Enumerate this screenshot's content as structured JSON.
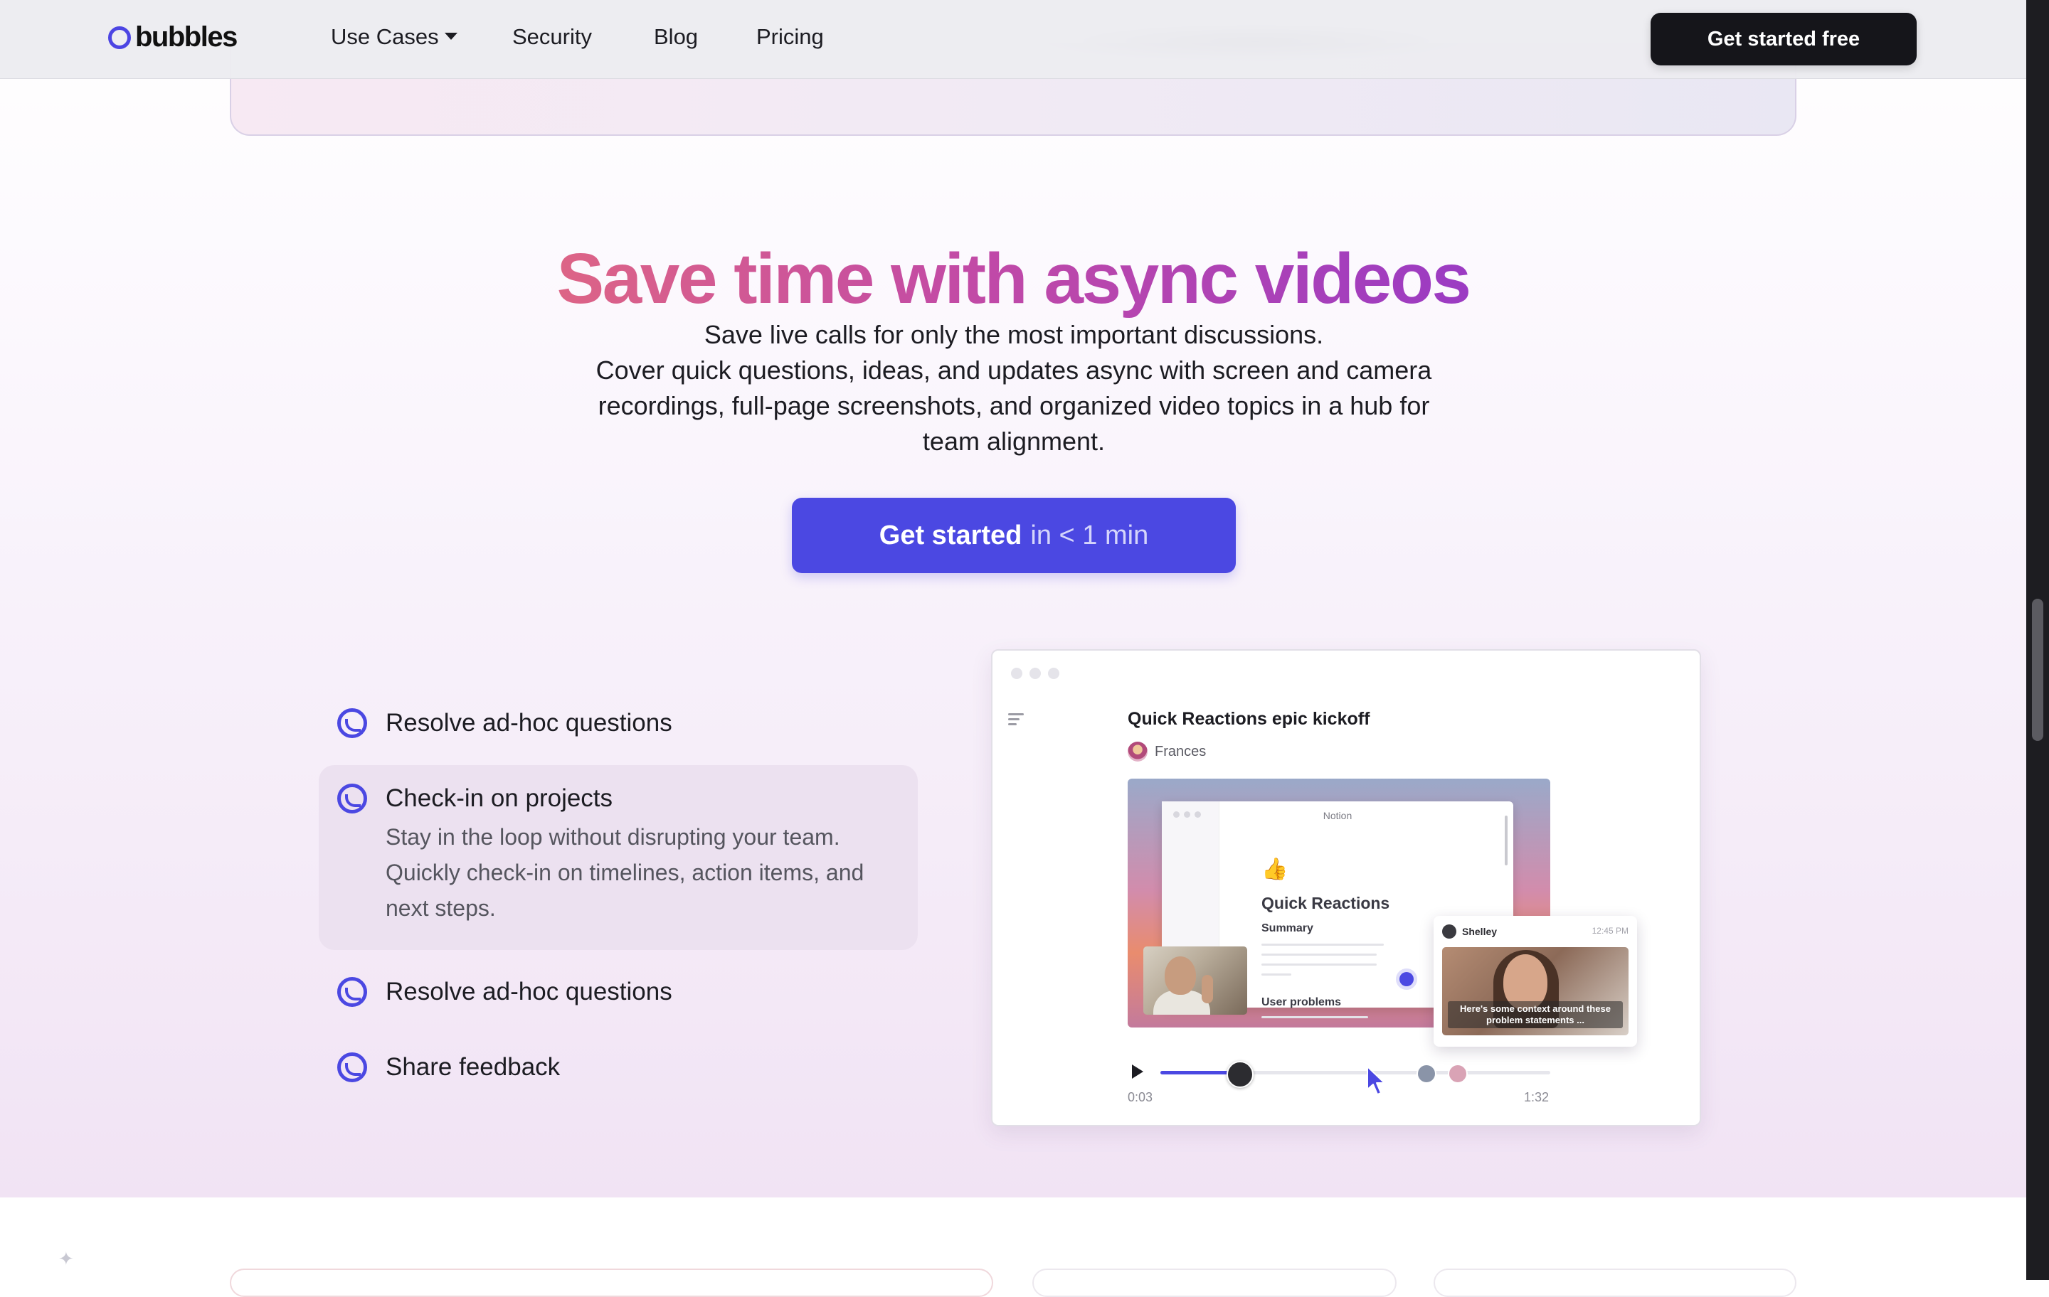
{
  "nav": {
    "brand": "bubbles",
    "items": [
      {
        "label": "Use Cases"
      },
      {
        "label": "Security"
      },
      {
        "label": "Blog"
      },
      {
        "label": "Pricing"
      }
    ],
    "cta_label": "Get started free"
  },
  "hero": {
    "headline": "Save time with async videos",
    "lines": [
      "Save live calls for only the most important discussions.",
      "Cover quick questions, ideas, and updates async with screen and camera recordings, full-page screenshots, and organized video topics in a hub for team alignment."
    ],
    "cta_bold": "Get started",
    "cta_muted": "in < 1 min"
  },
  "features": [
    {
      "title": "Resolve ad-hoc questions",
      "active": false
    },
    {
      "title": "Check-in on projects",
      "active": true,
      "description": "Stay in the loop without disrupting your team. Quickly check-in on timelines, action items, and next steps."
    },
    {
      "title": "Resolve ad-hoc questions",
      "active": false
    },
    {
      "title": "Share feedback",
      "active": false
    }
  ],
  "demo": {
    "title": "Quick Reactions epic kickoff",
    "author": "Frances",
    "inner_window": {
      "app_label": "Notion",
      "emoji": "👍",
      "heading": "Quick Reactions",
      "summary_label": "Summary",
      "problems_label": "User problems"
    },
    "comment": {
      "author": "Shelley",
      "time": "12:45 PM",
      "caption": "Here's some context around these problem statements ..."
    },
    "player": {
      "current_time": "0:03",
      "duration": "1:32",
      "progress_fraction": 0.2
    }
  },
  "colors": {
    "brand": "#4b48e2",
    "headline_gradient": [
      "#dd6486",
      "#c24aa6",
      "#9b3bc3"
    ],
    "dark_button": "#15151a"
  }
}
